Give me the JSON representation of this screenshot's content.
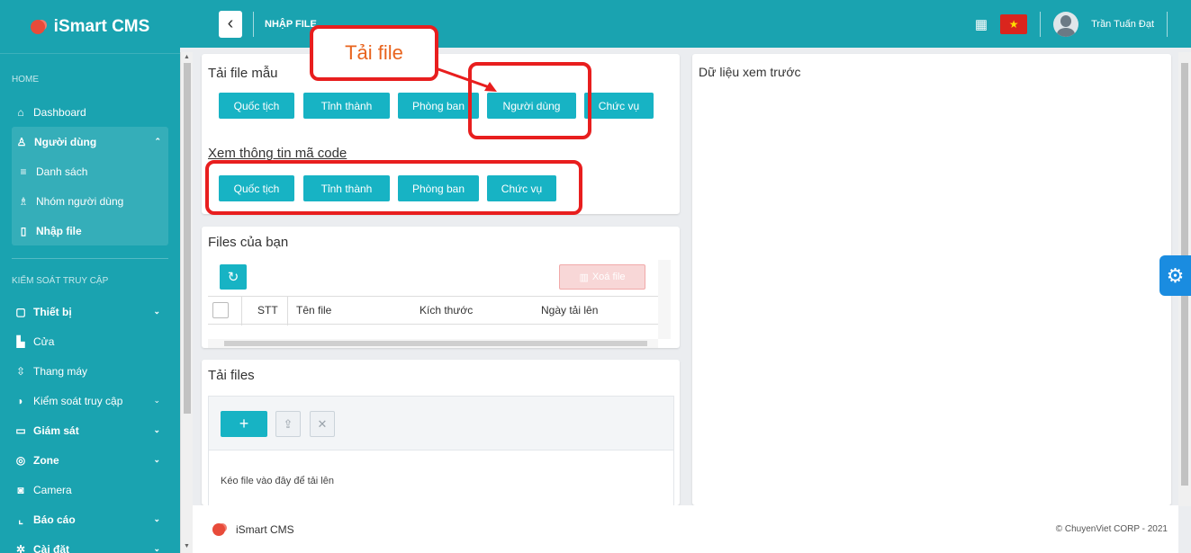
{
  "sidebar": {
    "brand": "iSmart CMS",
    "section_home": "HOME",
    "dashboard": "Dashboard",
    "users": "Người dùng",
    "users_list": "Danh sách",
    "users_groups": "Nhóm người dùng",
    "users_import": "Nhập file",
    "section_access": "KIỂM SOÁT TRUY CẬP",
    "devices": "Thiết bị",
    "doors": "Cửa",
    "elevator": "Thang máy",
    "access_control": "Kiểm soát truy cập",
    "monitoring": "Giám sát",
    "zone": "Zone",
    "camera": "Camera",
    "reports": "Báo cáo",
    "settings": "Cài đặt"
  },
  "topbar": {
    "title": "NHẬP FILE",
    "user_name": "Trần Tuấn Đạt"
  },
  "templates": {
    "title": "Tải file mẫu",
    "buttons": [
      "Quốc tịch",
      "Tỉnh thành",
      "Phòng ban",
      "Người dùng",
      "Chức vụ"
    ]
  },
  "codes": {
    "title": "Xem thông tin mã code",
    "buttons": [
      "Quốc tịch",
      "Tỉnh thành",
      "Phòng ban",
      "Chức vụ"
    ]
  },
  "callout": "Tải file",
  "files": {
    "title": "Files của bạn",
    "delete_label": "Xoá file",
    "columns": [
      "STT",
      "Tên file",
      "Kích thước",
      "Ngày tải lên"
    ]
  },
  "upload": {
    "title": "Tải files",
    "drop_hint": "Kéo file vào đây để tải lên"
  },
  "preview": {
    "title": "Dữ liệu xem trước"
  },
  "footer": {
    "brand": "iSmart CMS",
    "copyright": "© ChuyenViet CORP - 2021"
  },
  "colors": {
    "primary": "#1aa3b0",
    "button": "#17b3c4",
    "highlight": "#e81e1e",
    "callout_text": "#e8641e"
  }
}
